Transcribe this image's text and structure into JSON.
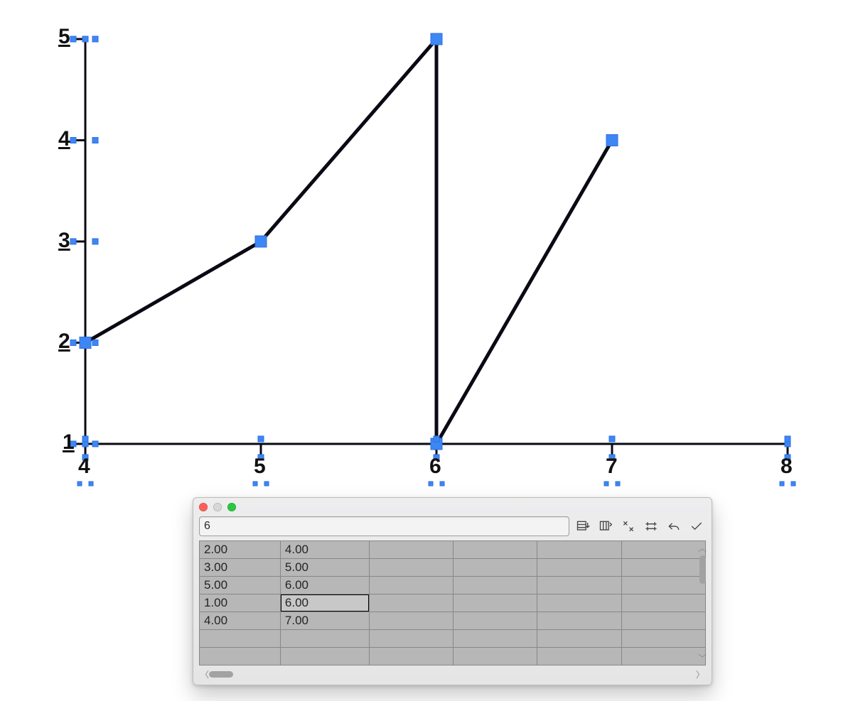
{
  "chart_data": {
    "type": "line",
    "x": [
      4,
      5,
      6,
      6,
      7
    ],
    "y": [
      2,
      3,
      5,
      1,
      4
    ],
    "xlim": [
      4,
      8
    ],
    "ylim": [
      1,
      5
    ],
    "xticks": [
      4,
      5,
      6,
      7,
      8
    ],
    "yticks": [
      1,
      2,
      3,
      4,
      5
    ],
    "title": "",
    "xlabel": "",
    "ylabel": ""
  },
  "chart": {
    "x_labels": {
      "0": "4",
      "1": "5",
      "2": "6",
      "3": "7",
      "4": "8"
    },
    "y_labels": {
      "0": "1",
      "1": "2",
      "2": "3",
      "3": "4",
      "4": "5"
    }
  },
  "window": {
    "search_value": "6",
    "table": {
      "rows": [
        {
          "c0": "2.00",
          "c1": "4.00"
        },
        {
          "c0": "3.00",
          "c1": "5.00"
        },
        {
          "c0": "5.00",
          "c1": "6.00"
        },
        {
          "c0": "1.00",
          "c1": "6.00"
        },
        {
          "c0": "4.00",
          "c1": "7.00"
        }
      ],
      "editing": {
        "row": 3,
        "col": 1
      }
    }
  }
}
